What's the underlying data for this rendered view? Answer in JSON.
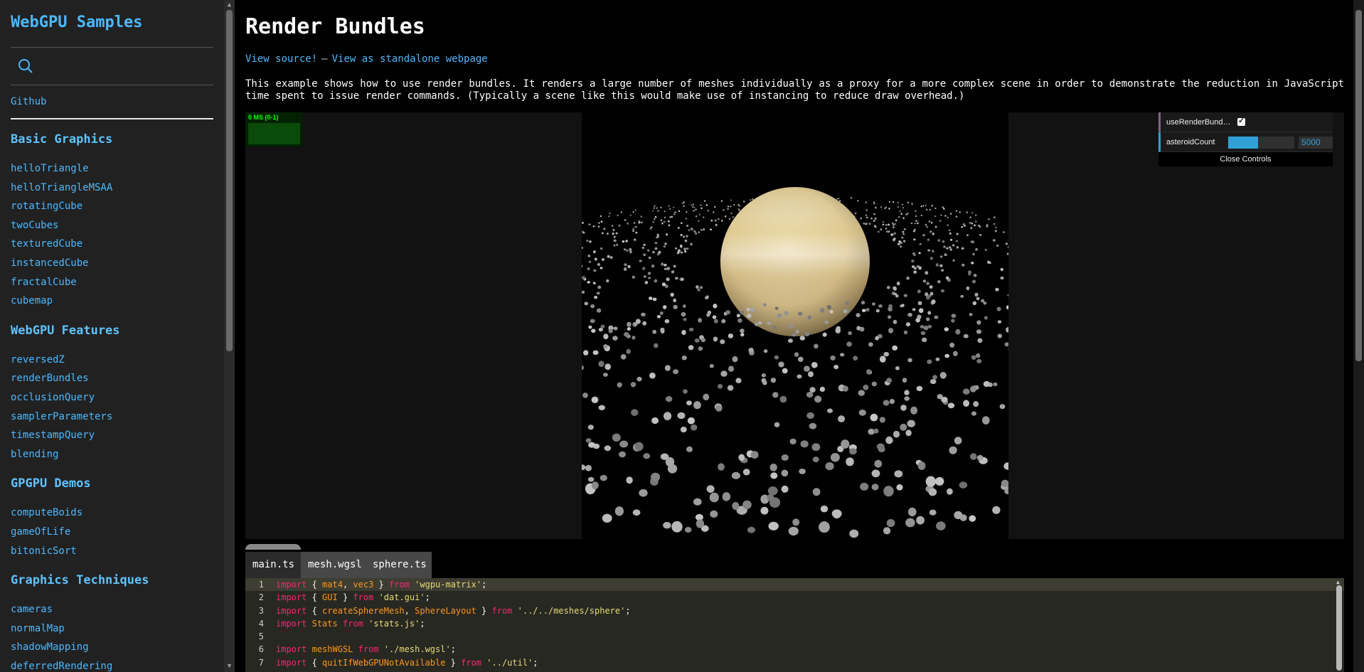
{
  "sidebar": {
    "brand": "WebGPU Samples",
    "search_icon": "search-icon",
    "github": "Github",
    "sections": [
      {
        "title": "Basic Graphics",
        "items": [
          "helloTriangle",
          "helloTriangleMSAA",
          "rotatingCube",
          "twoCubes",
          "texturedCube",
          "instancedCube",
          "fractalCube",
          "cubemap"
        ]
      },
      {
        "title": "WebGPU Features",
        "items": [
          "reversedZ",
          "renderBundles",
          "occlusionQuery",
          "samplerParameters",
          "timestampQuery",
          "blending"
        ]
      },
      {
        "title": "GPGPU Demos",
        "items": [
          "computeBoids",
          "gameOfLife",
          "bitonicSort"
        ]
      },
      {
        "title": "Graphics Techniques",
        "items": [
          "cameras",
          "normalMap",
          "shadowMapping",
          "deferredRendering"
        ]
      }
    ]
  },
  "main": {
    "title": "Render Bundles",
    "view_source": "View source!",
    "separator": "—",
    "view_standalone": "View as standalone webpage",
    "description": "This example shows how to use render bundles. It renders a large number of meshes individually as a proxy for a more complex scene in order to demonstrate the reduction in JavaScript time spent to issue render commands. (Typically a scene like this would make use of instancing to reduce draw overhead.)"
  },
  "stats": {
    "text": "0 MS (0-1)"
  },
  "gui": {
    "use_render_bundles_label": "useRenderBund…",
    "use_render_bundles_checked": true,
    "asteroid_count_label": "asteroidCount",
    "asteroid_count_value": "5000",
    "asteroid_slider_fraction": 0.45,
    "close_label": "Close Controls",
    "colors": {
      "bool": "#806787",
      "number": "#2fa1d6"
    }
  },
  "tabs": [
    "main.ts",
    "mesh.wgsl",
    "sphere.ts"
  ],
  "code": {
    "lines": [
      {
        "n": "1",
        "tokens": [
          [
            "kw",
            "import"
          ],
          [
            "txt",
            " { "
          ],
          [
            "id",
            "mat4"
          ],
          [
            "txt",
            ", "
          ],
          [
            "id",
            "vec3"
          ],
          [
            "txt",
            " } "
          ],
          [
            "kw",
            "from"
          ],
          [
            "txt",
            " "
          ],
          [
            "str",
            "'wgpu-matrix'"
          ],
          [
            "txt",
            ";"
          ]
        ]
      },
      {
        "n": "2",
        "tokens": [
          [
            "kw",
            "import"
          ],
          [
            "txt",
            " { "
          ],
          [
            "id",
            "GUI"
          ],
          [
            "txt",
            " } "
          ],
          [
            "kw",
            "from"
          ],
          [
            "txt",
            " "
          ],
          [
            "str",
            "'dat.gui'"
          ],
          [
            "txt",
            ";"
          ]
        ]
      },
      {
        "n": "3",
        "tokens": [
          [
            "kw",
            "import"
          ],
          [
            "txt",
            " { "
          ],
          [
            "id",
            "createSphereMesh"
          ],
          [
            "txt",
            ", "
          ],
          [
            "id",
            "SphereLayout"
          ],
          [
            "txt",
            " } "
          ],
          [
            "kw",
            "from"
          ],
          [
            "txt",
            " "
          ],
          [
            "str",
            "'../../meshes/sphere'"
          ],
          [
            "txt",
            ";"
          ]
        ]
      },
      {
        "n": "4",
        "tokens": [
          [
            "kw",
            "import"
          ],
          [
            "txt",
            " "
          ],
          [
            "id",
            "Stats"
          ],
          [
            "txt",
            " "
          ],
          [
            "kw",
            "from"
          ],
          [
            "txt",
            " "
          ],
          [
            "str",
            "'stats.js'"
          ],
          [
            "txt",
            ";"
          ]
        ]
      },
      {
        "n": "5",
        "tokens": []
      },
      {
        "n": "6",
        "tokens": [
          [
            "kw",
            "import"
          ],
          [
            "txt",
            " "
          ],
          [
            "id",
            "meshWGSL"
          ],
          [
            "txt",
            " "
          ],
          [
            "kw",
            "from"
          ],
          [
            "txt",
            " "
          ],
          [
            "str",
            "'./mesh.wgsl'"
          ],
          [
            "txt",
            ";"
          ]
        ]
      },
      {
        "n": "7",
        "tokens": [
          [
            "kw",
            "import"
          ],
          [
            "txt",
            " { "
          ],
          [
            "id",
            "quitIfWebGPUNotAvailable"
          ],
          [
            "txt",
            " } "
          ],
          [
            "kw",
            "from"
          ],
          [
            "txt",
            " "
          ],
          [
            "str",
            "'../util'"
          ],
          [
            "txt",
            ";"
          ]
        ]
      }
    ]
  }
}
